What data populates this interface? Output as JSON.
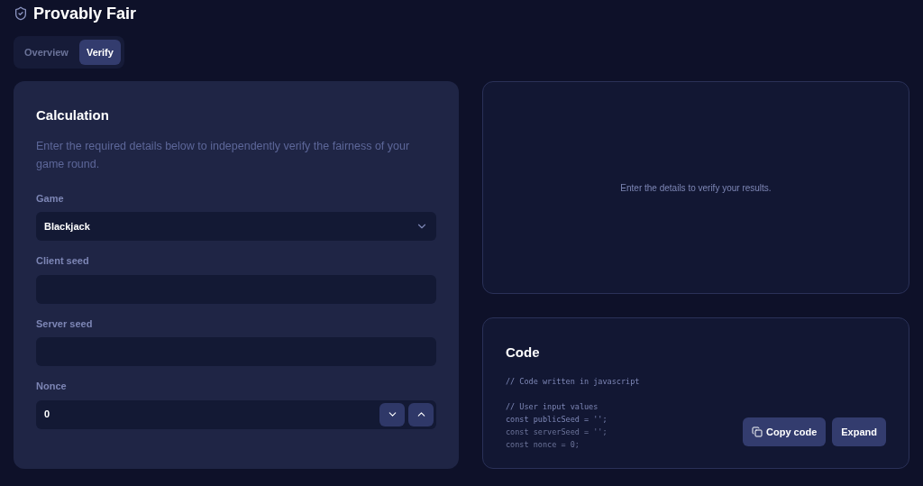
{
  "header": {
    "title": "Provably Fair"
  },
  "tabs": [
    {
      "label": "Overview",
      "selected": false
    },
    {
      "label": "Verify",
      "selected": true
    }
  ],
  "calculation": {
    "title": "Calculation",
    "description": "Enter the required details below to independently verify the fairness of your game round.",
    "fields": [
      {
        "kind": "select",
        "label": "Game",
        "value": "Blackjack"
      },
      {
        "kind": "text",
        "label": "Client seed"
      },
      {
        "kind": "text",
        "label": "Server seed"
      },
      {
        "kind": "number",
        "label": "Nonce",
        "value": "0"
      }
    ]
  },
  "result": {
    "message": "Enter the details to verify your results."
  },
  "code": {
    "title": "Code",
    "blocks": [
      [
        "// Code written in javascript"
      ],
      [
        "// User input values",
        "const publicSeed = '';",
        "const serverSeed = '';",
        "const nonce = 0;"
      ]
    ],
    "buttons": [
      "Copy code",
      "Expand"
    ]
  }
}
